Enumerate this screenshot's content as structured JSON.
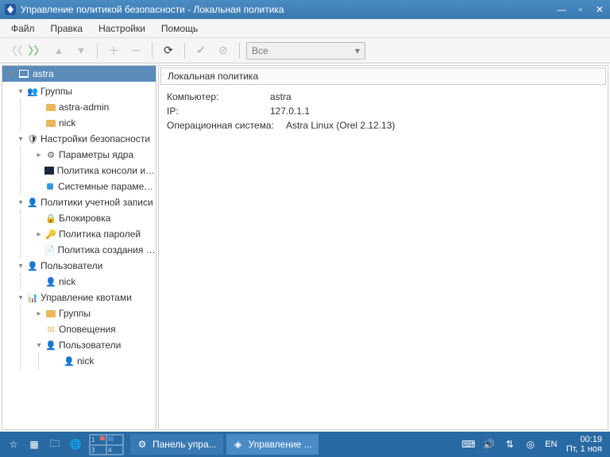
{
  "titlebar": {
    "title": "Управление политикой безопасности - Локальная политика"
  },
  "menu": {
    "file": "Файл",
    "edit": "Правка",
    "settings": "Настройки",
    "help": "Помощь"
  },
  "toolbar": {
    "filter": "Все"
  },
  "tree": {
    "root": "astra",
    "groups": {
      "label": "Группы",
      "items": [
        "astra-admin",
        "nick"
      ]
    },
    "security": {
      "label": "Настройки безопасности",
      "kernel": "Параметры ядра",
      "console": "Политика консоли и ин...",
      "system": "Системные параметры"
    },
    "account_policies": {
      "label": "Политики учетной записи",
      "lockout": "Блокировка",
      "password": "Политика паролей",
      "creation": "Политика создания пол..."
    },
    "users": {
      "label": "Пользователи",
      "items": [
        "nick"
      ]
    },
    "quotas": {
      "label": "Управление квотами",
      "groups": "Группы",
      "notify": "Оповещения",
      "users_label": "Пользователи",
      "users": [
        "nick"
      ]
    }
  },
  "main": {
    "header": "Локальная политика",
    "rows": {
      "computer_l": "Компьютер:",
      "computer_v": "astra",
      "ip_l": "IP:",
      "ip_v": "127.0.1.1",
      "os_l": "Операционная система:",
      "os_v": "Astra Linux (Orel 2.12.13)"
    }
  },
  "taskbar": {
    "pager": [
      "1",
      "2",
      "3",
      "4"
    ],
    "tasks": {
      "control_panel": "Панель упра...",
      "app": "Управление ..."
    },
    "lang": "EN",
    "clock": {
      "time": "00:19",
      "date": "Пт, 1 ноя"
    }
  }
}
